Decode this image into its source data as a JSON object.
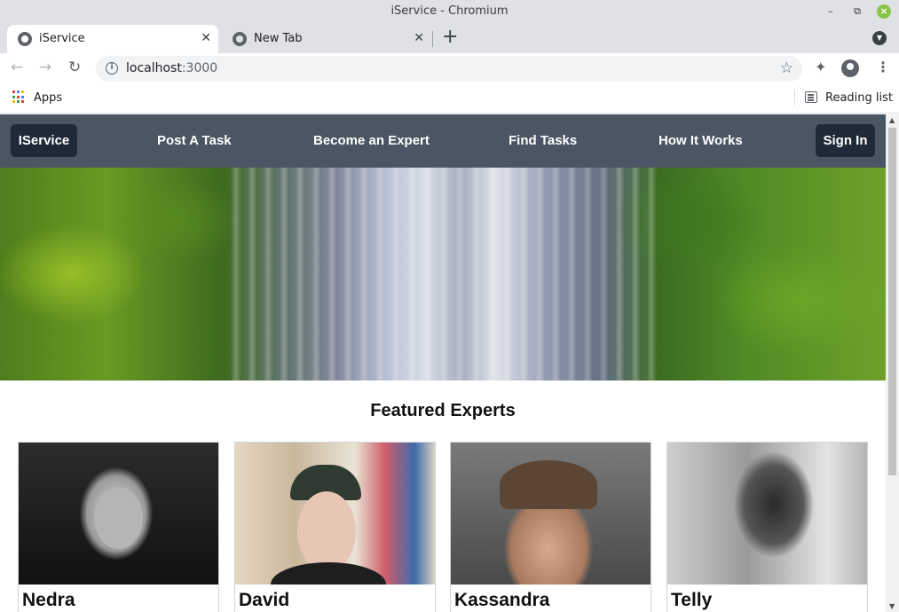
{
  "window": {
    "title": "iService - Chromium"
  },
  "tabs": [
    {
      "label": "iService",
      "active": true
    },
    {
      "label": "New Tab",
      "active": false
    }
  ],
  "address_bar": {
    "host": "localhost",
    "port": ":3000"
  },
  "bookmarks": {
    "apps_label": "Apps",
    "reading_list_label": "Reading list"
  },
  "site": {
    "brand": "IService",
    "nav": [
      "Post A Task",
      "Become an Expert",
      "Find Tasks",
      "How It Works"
    ],
    "sign_in": "Sign In",
    "featured_title": "Featured Experts",
    "experts": [
      {
        "name": "Nedra"
      },
      {
        "name": "David"
      },
      {
        "name": "Kassandra"
      },
      {
        "name": "Telly"
      }
    ]
  },
  "colors": {
    "nav_bg": "#4b5563",
    "button_bg": "#1f2937",
    "chrome_bg": "#dfe1e5"
  }
}
